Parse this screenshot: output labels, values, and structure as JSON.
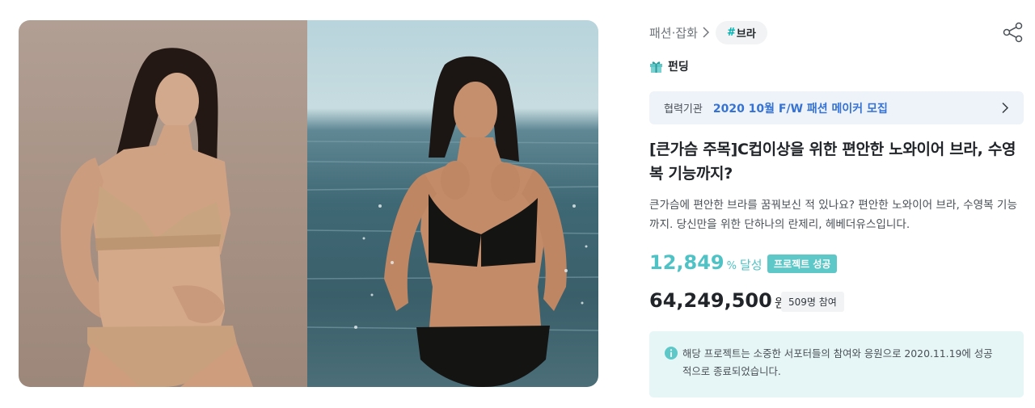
{
  "breadcrumb": {
    "category": "패션·잡화",
    "tag_hash": "#",
    "tag": "브라"
  },
  "icons": {
    "share": "share-icon",
    "gift": "gift-icon",
    "chevron": "chevron-right-icon",
    "info": "info-icon"
  },
  "funding_label": "펀딩",
  "partner": {
    "label": "협력기관",
    "value": "2020 10월 F/W 패션 메이커 모집"
  },
  "title": "[큰가슴 주목]C컵이상을 위한 편안한 노와이어 브라, 수영복 기능까지?",
  "description": "큰가슴에 편안한 브라를 꿈꿔보신 적 있나요? 편안한 노와이어 브라, 수영복 기능까지. 당신만을 위한 단하나의 란제리, 헤베더유스입니다.",
  "achievement": {
    "rate": "12,849",
    "percent": "%",
    "label": "달성",
    "badge": "프로젝트 성공"
  },
  "amount": {
    "value": "64,249,500",
    "unit": "원",
    "backers": "509명 참여"
  },
  "notice": {
    "text": "해당 프로젝트는 소중한 서포터들의 참여와 응원으로 2020.11.19에 성공적으로 종료되었습니다."
  },
  "colors": {
    "accent": "#4fc2c5",
    "partner_link": "#3572d3",
    "notice_bg": "#e6f6f6"
  }
}
